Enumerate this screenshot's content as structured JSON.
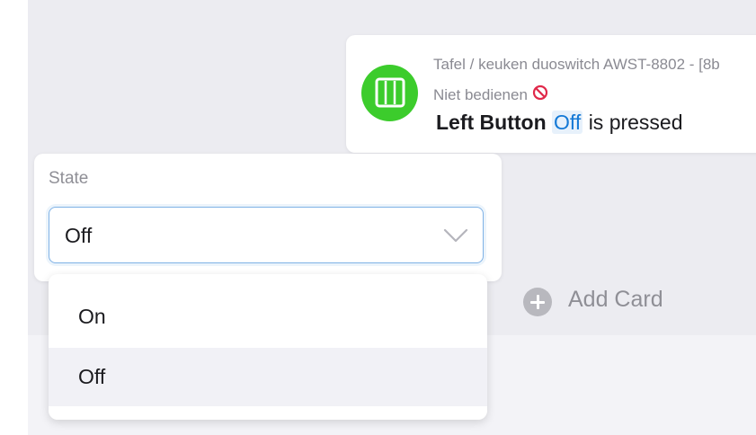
{
  "flow_card": {
    "zone_device": "Tafel / keuken duoswitch AWST-8802 - [8b",
    "subtitle": "Niet bedienen",
    "title_prefix": "Left Button",
    "title_tag": "Off",
    "title_suffix": "is pressed",
    "icon": "double-switch-icon",
    "icon_color": "#3ccc2c",
    "status_icon": "no-entry-icon"
  },
  "state_field": {
    "label": "State",
    "value": "Off",
    "chevron_icon": "chevron-down-icon"
  },
  "dropdown": {
    "options": [
      "On",
      "Off"
    ],
    "highlighted": "Off"
  },
  "add_card": {
    "label": "Add Card",
    "icon": "plus-circle-icon"
  }
}
